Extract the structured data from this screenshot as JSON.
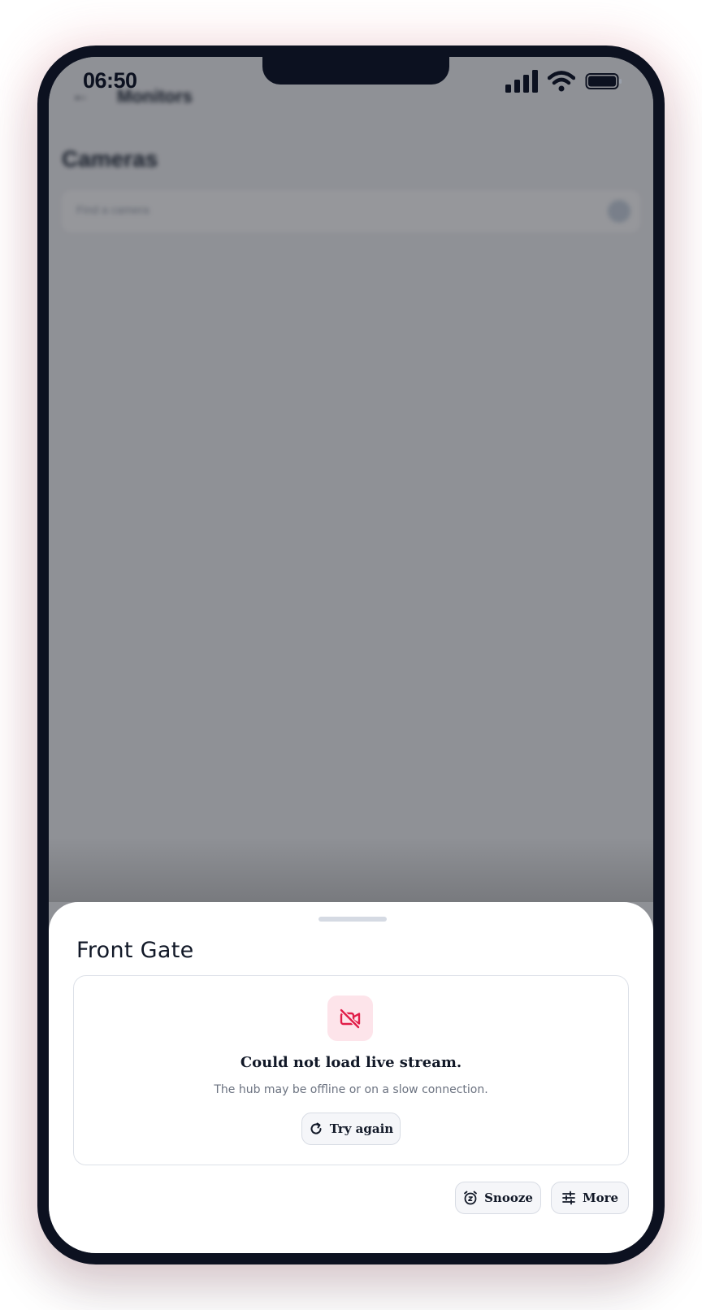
{
  "status_bar": {
    "time": "06:50",
    "icons": [
      "signal-icon",
      "wifi-icon",
      "battery-icon"
    ]
  },
  "background_app": {
    "nav_title": "Monitors",
    "heading": "Cameras",
    "search_placeholder": "Find a camera"
  },
  "sheet": {
    "title": "Front Gate",
    "error_card": {
      "icon": "video-off-icon",
      "title": "Could not load live stream.",
      "subtitle": "The hub may be offline or on a slow connection.",
      "retry_label": "Try again",
      "retry_icon": "refresh-icon"
    },
    "actions": {
      "snooze_label": "Snooze",
      "snooze_icon": "alarm-snooze-icon",
      "more_label": "More",
      "more_icon": "sliders-icon"
    }
  },
  "colors": {
    "accent_error": "#e11d48",
    "error_bg": "#fde4ea",
    "frame": "#0c1120"
  }
}
